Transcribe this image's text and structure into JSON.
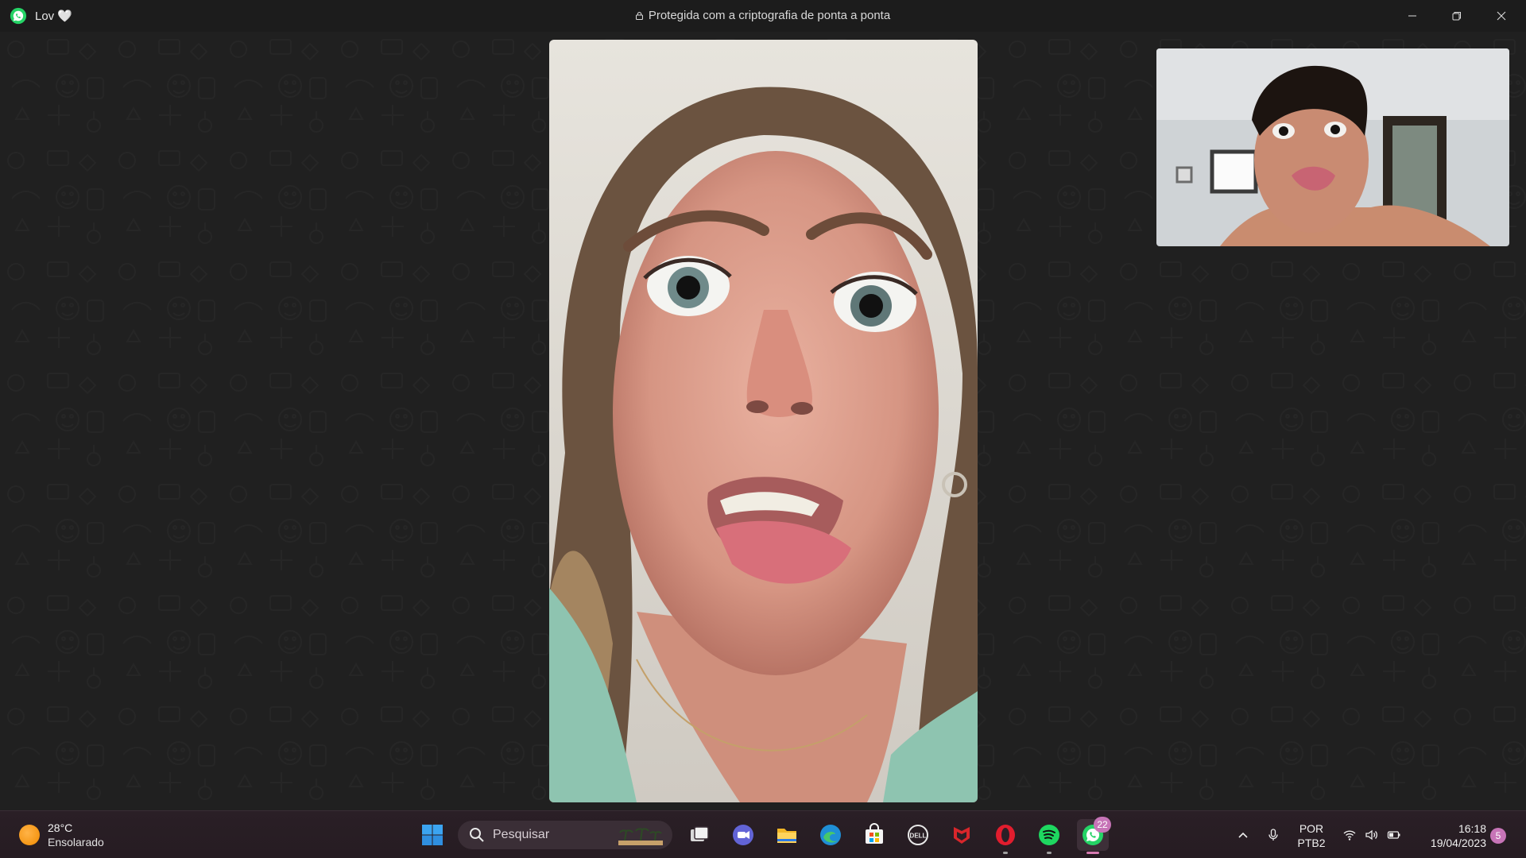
{
  "window": {
    "contact_name": "Lov 🤍",
    "encryption_text": "Protegida com a criptografia de ponta a ponta",
    "app_icon": "whatsapp-icon",
    "controls": [
      "minimize-icon",
      "restore-icon",
      "close-icon"
    ]
  },
  "call": {
    "remote_video": "remote-participant-video",
    "self_video": "self-preview-video",
    "background_color": "#202020"
  },
  "taskbar": {
    "weather": {
      "temperature": "28°C",
      "condition": "Ensolarado",
      "icon": "sun-icon"
    },
    "search": {
      "label": "Pesquisar",
      "icon": "search-icon"
    },
    "apps": [
      {
        "name": "start-icon"
      },
      {
        "name": "task-view-icon"
      },
      {
        "name": "teams-meet-icon"
      },
      {
        "name": "file-explorer-icon"
      },
      {
        "name": "edge-icon"
      },
      {
        "name": "microsoft-store-icon"
      },
      {
        "name": "dell-icon"
      },
      {
        "name": "mcafee-icon"
      },
      {
        "name": "opera-icon"
      },
      {
        "name": "spotify-icon"
      },
      {
        "name": "whatsapp-icon",
        "badge": "22"
      }
    ],
    "tray": {
      "language_line1": "POR",
      "language_line2": "PTB2",
      "time": "16:18",
      "date": "19/04/2023",
      "notification_count": "5",
      "icons": [
        "chevron-up-icon",
        "microphone-icon",
        "wifi-icon",
        "volume-icon",
        "battery-icon"
      ]
    },
    "accent_color": "#c774b7"
  }
}
